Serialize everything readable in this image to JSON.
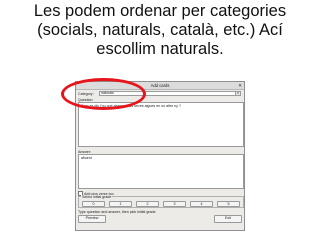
{
  "caption": {
    "line1": "Les podem ordenar per categories",
    "line2": "(socials, naturals, català, etc.) Ací",
    "line3": "escollim naturals."
  },
  "dialog": {
    "title": "Add cards",
    "close_glyph": "✕",
    "category_label": "Category:",
    "category_value": "naturals",
    "question_label": "Question:",
    "question_text": "Com es diu l'ou que abaquen les seves algues en un altre ny ?",
    "answer_label": "Answer:",
    "answer_text": "afluent",
    "reverse_label": "Add pics verse too",
    "grade_legend": "Select initial grade",
    "grades": [
      "0",
      "1",
      "2",
      "3",
      "4",
      "5"
    ],
    "hint": "Type question and answer, then pick initial grade.",
    "preview_label": "Preview",
    "exit_label": "Exit"
  },
  "colors": {
    "highlight": "#e8141c",
    "dialog_bg": "#ecebe8"
  }
}
